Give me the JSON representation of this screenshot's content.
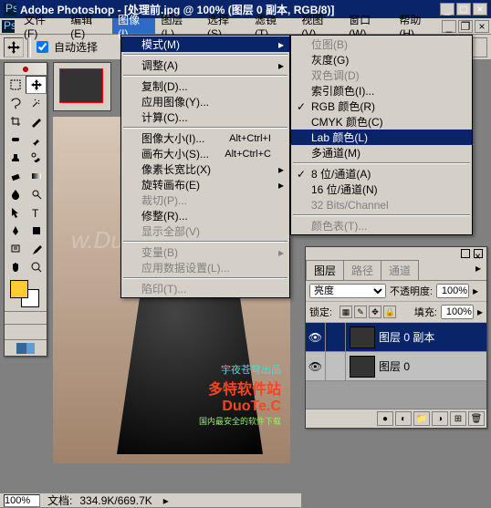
{
  "app": "Adobe Photoshop",
  "title": "Adobe Photoshop - [处理前.jpg @ 100% (图层 0 副本, RGB/8)]",
  "menubar": {
    "items": [
      "文件(F)",
      "编辑(E)",
      "图像(I)",
      "图层(L)",
      "选择(S)",
      "滤镜(T)",
      "视图(V)",
      "窗口(W)",
      "帮助(H)"
    ],
    "active_index": 2
  },
  "optbar": {
    "auto_select": "自动选择"
  },
  "image_menu": {
    "mode": "模式(M)",
    "adjust": "调整(A)",
    "duplicate": "复制(D)...",
    "apply_image": "应用图像(Y)...",
    "calculations": "计算(C)...",
    "image_size": {
      "label": "图像大小(I)...",
      "shortcut": "Alt+Ctrl+I"
    },
    "canvas_size": {
      "label": "画布大小(S)...",
      "shortcut": "Alt+Ctrl+C"
    },
    "pixel_ratio": "像素长宽比(X)",
    "rotate_canvas": "旋转画布(E)",
    "crop": "裁切(P)...",
    "trim": "修整(R)...",
    "reveal_all": "显示全部(V)",
    "variables": "变量(B)",
    "apply_data": "应用数据设置(L)...",
    "trap": "陷印(T)..."
  },
  "mode_menu": {
    "bitmap": "位图(B)",
    "grayscale": "灰度(G)",
    "duotone": "双色调(D)",
    "indexed": "索引颜色(I)...",
    "rgb": "RGB 颜色(R)",
    "cmyk": "CMYK 颜色(C)",
    "lab": "Lab 颜色(L)",
    "multichannel": "多通道(M)",
    "bits8": "8 位/通道(A)",
    "bits16": "16 位/通道(N)",
    "bits32": "32 Bits/Channel",
    "color_table": "颜色表(T)..."
  },
  "layers_panel": {
    "tabs": [
      "图层",
      "路径",
      "通道"
    ],
    "blend": "亮度",
    "opacity_label": "不透明度:",
    "opacity_value": "100%",
    "lock_label": "锁定:",
    "fill_label": "填充:",
    "fill_value": "100%",
    "layers": [
      {
        "name": "图层 0 副本",
        "selected": true
      },
      {
        "name": "图层 0",
        "selected": false
      }
    ]
  },
  "status": {
    "zoom": "100%",
    "doc_label": "文档:",
    "doc_size": "334.9K/669.7K"
  },
  "banner": {
    "b1": "宇夜苍穹出品",
    "b2": "多特软件站",
    "b3": "DuoTe.C",
    "b4": "国内最安全的软件下载"
  },
  "watermark": "w.DuoTe.C"
}
